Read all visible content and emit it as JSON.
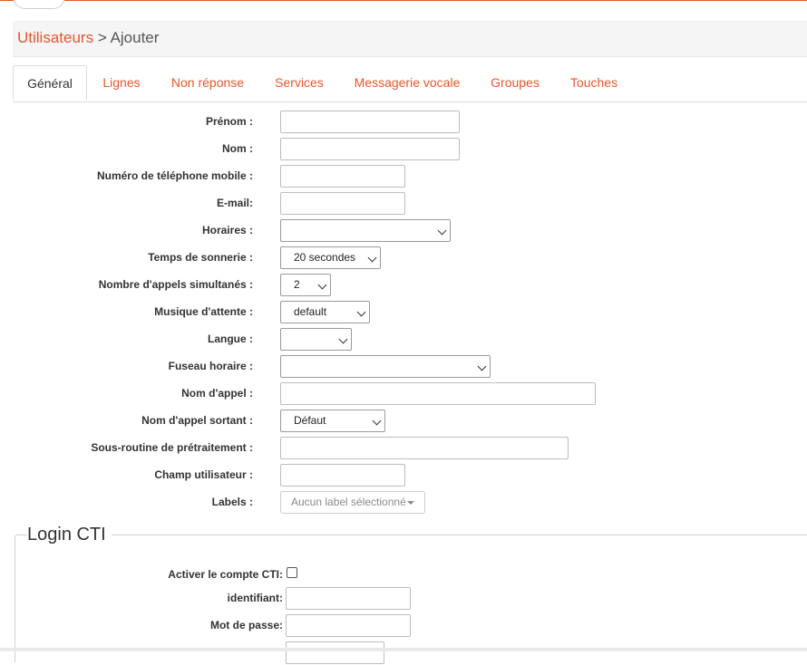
{
  "breadcrumb": {
    "parent": "Utilisateurs",
    "separator": ">",
    "current": "Ajouter"
  },
  "tabs": [
    {
      "label": "Général",
      "active": true
    },
    {
      "label": "Lignes",
      "active": false
    },
    {
      "label": "Non réponse",
      "active": false
    },
    {
      "label": "Services",
      "active": false
    },
    {
      "label": "Messagerie vocale",
      "active": false
    },
    {
      "label": "Groupes",
      "active": false
    },
    {
      "label": "Touches",
      "active": false
    }
  ],
  "form": {
    "prenom_label": "Prénom :",
    "nom_label": "Nom :",
    "mobile_label": "Numéro de téléphone mobile :",
    "email_label": "E-mail:",
    "horaires_label": "Horaires :",
    "horaires_value": "",
    "sonnerie_label": "Temps de sonnerie :",
    "sonnerie_value": "20 secondes",
    "appels_label": "Nombre d'appels simultanés :",
    "appels_value": "2",
    "musique_label": "Musique d'attente :",
    "musique_value": "default",
    "langue_label": "Langue :",
    "langue_value": "",
    "fuseau_label": "Fuseau horaire :",
    "fuseau_value": "",
    "nom_appel_label": "Nom d'appel :",
    "nom_appel_sortant_label": "Nom d'appel sortant :",
    "nom_appel_sortant_value": "Défaut",
    "sous_routine_label": "Sous-routine de prétraitement :",
    "champ_label": "Champ utilisateur :",
    "labels_label": "Labels :",
    "labels_placeholder": "Aucun label sélectionné"
  },
  "cti": {
    "legend": "Login CTI",
    "activer_label": "Activer le compte CTI:",
    "activer_checked": false,
    "identifiant_label": "identifiant:",
    "mot_de_passe_label": "Mot de passe:"
  },
  "colors": {
    "accent": "#e8562a",
    "text": "#333333",
    "border": "#dddddd"
  }
}
